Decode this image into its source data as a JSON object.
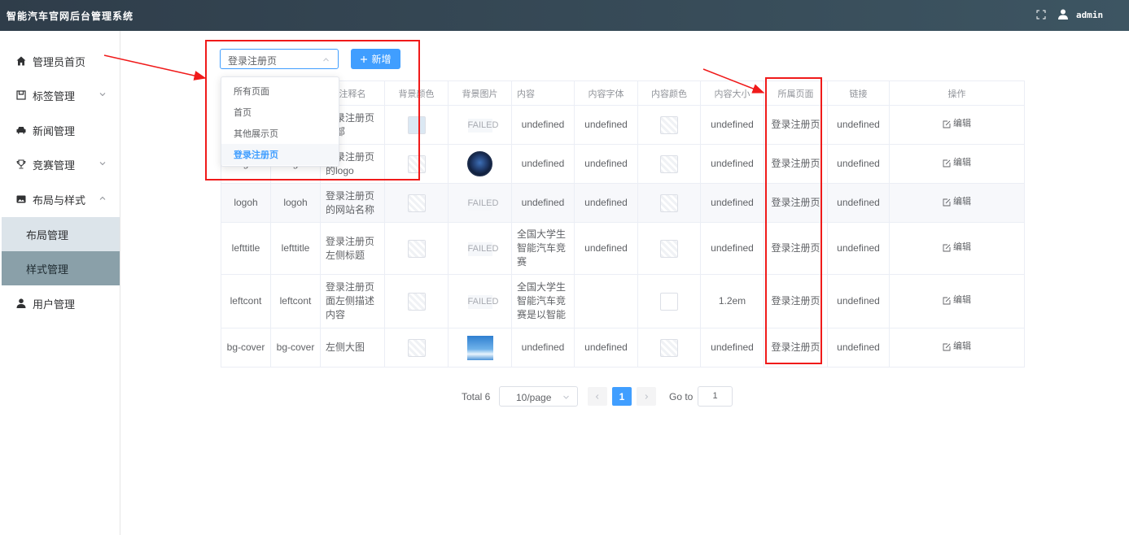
{
  "app": {
    "title": "智能汽车官网后台管理系统",
    "username": "admin"
  },
  "sidebar": {
    "items": [
      {
        "label": "管理员首页",
        "icon": "home-icon"
      },
      {
        "label": "标签管理",
        "icon": "tag-icon"
      },
      {
        "label": "新闻管理",
        "icon": "car-icon"
      },
      {
        "label": "竞赛管理",
        "icon": "trophy-icon"
      },
      {
        "label": "布局与样式",
        "icon": "image-icon"
      },
      {
        "label": "用户管理",
        "icon": "user-icon"
      }
    ],
    "subitems": [
      "布局管理",
      "样式管理"
    ]
  },
  "toolbar": {
    "select_value": "登录注册页",
    "add_label": "新增",
    "options": [
      "所有页面",
      "首页",
      "其他展示页",
      "登录注册页"
    ],
    "selected_option": "登录注册页"
  },
  "table": {
    "headers": [
      "",
      "",
      "注释名",
      "背景颜色",
      "背景图片",
      "内容",
      "内容字体",
      "内容颜色",
      "内容大小",
      "所属页面",
      "链接",
      "操作"
    ],
    "rows": [
      {
        "c1": "",
        "c2": "",
        "c3": "登录注册页头部",
        "bg": "blue",
        "img": "FAILED",
        "content": "undefined",
        "font": "undefined",
        "color": "ph",
        "size": "undefined",
        "page": "登录注册页",
        "link": "undefined",
        "op": "编辑"
      },
      {
        "c1": "g",
        "c2": "g",
        "c3": "登录注册页的logo",
        "bg": "ph",
        "img": "logo",
        "content": "undefined",
        "font": "undefined",
        "color": "ph",
        "size": "undefined",
        "page": "登录注册页",
        "link": "undefined",
        "op": "编辑"
      },
      {
        "c1": "logoh",
        "c2": "logoh",
        "c3": "登录注册页的网站名称",
        "bg": "ph",
        "img": "FAILED",
        "content": "undefined",
        "font": "undefined",
        "color": "ph",
        "size": "undefined",
        "page": "登录注册页",
        "link": "undefined",
        "op": "编辑"
      },
      {
        "c1": "lefttitle",
        "c2": "lefttitle",
        "c3": "登录注册页左侧标题",
        "bg": "ph",
        "img": "FAILED",
        "content": "全国大学生智能汽车竞赛",
        "font": "undefined",
        "color": "ph",
        "size": "undefined",
        "page": "登录注册页",
        "link": "undefined",
        "op": "编辑"
      },
      {
        "c1": "leftcont",
        "c2": "leftcont",
        "c3": "登录注册页面左侧描述内容",
        "bg": "ph",
        "img": "FAILED",
        "content": "全国大学生智能汽车竞赛是以智能",
        "font": "",
        "color": "blank",
        "size": "1.2em",
        "page": "登录注册页",
        "link": "undefined",
        "op": "编辑"
      },
      {
        "c1": "bg-cover",
        "c2": "bg-cover",
        "c3": "左侧大图",
        "bg": "ph",
        "img": "sky",
        "content": "undefined",
        "font": "undefined",
        "color": "ph",
        "size": "undefined",
        "page": "登录注册页",
        "link": "undefined",
        "op": "编辑"
      }
    ]
  },
  "pagination": {
    "total": "Total 6",
    "page_size": "10/page",
    "current": "1",
    "goto_label": "Go to",
    "goto_value": "1"
  },
  "colors": {
    "primary": "#409eff",
    "header_bg": "#2f3d4a",
    "annotation_red": "#f01a1a"
  }
}
